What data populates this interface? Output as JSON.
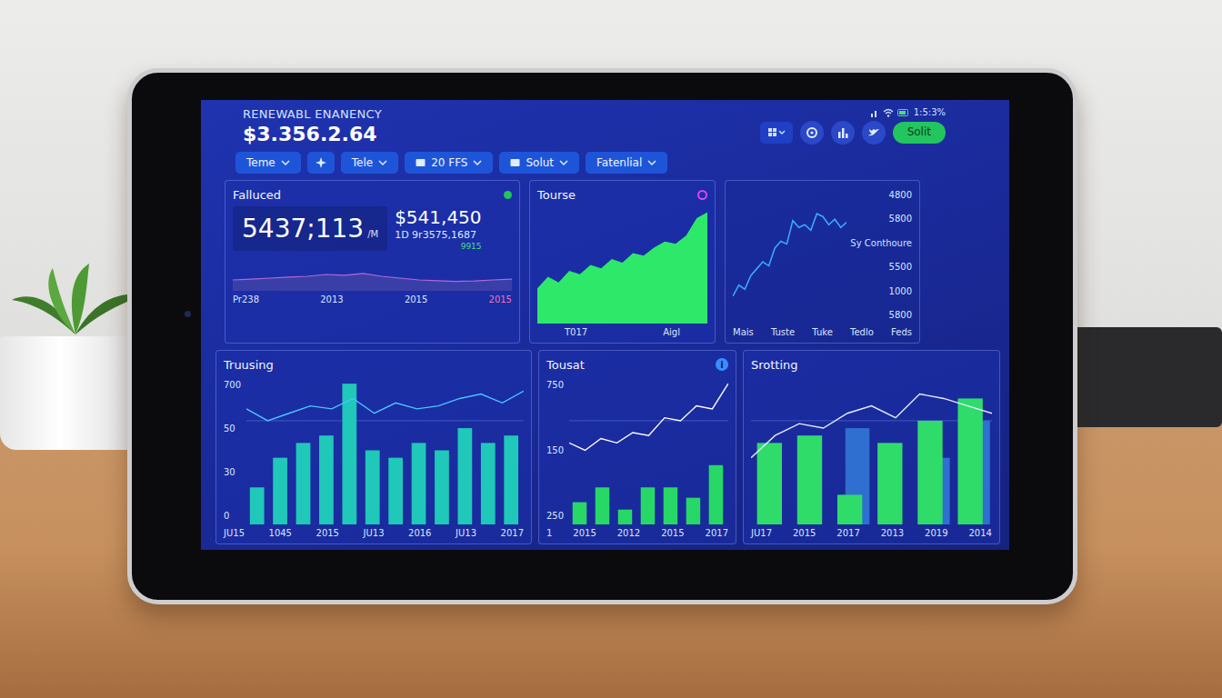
{
  "screen": {
    "title": "RENEWABL ENANENCY",
    "total": "$3.356.2.64",
    "status": "1:5:3%",
    "action_button": "Solit"
  },
  "filters": [
    {
      "label": "Teme",
      "kind": "dropdown"
    },
    {
      "label": "",
      "kind": "icon"
    },
    {
      "label": "Tele",
      "kind": "dropdown"
    },
    {
      "label": "20 FFS",
      "kind": "icon-dropdown"
    },
    {
      "label": "Solut",
      "kind": "icon-dropdown"
    },
    {
      "label": "Fatenlial",
      "kind": "dropdown"
    }
  ],
  "summary_panel": {
    "title": "Falluced",
    "dot_color": "#22c55e",
    "value": "5437;113",
    "unit": "/M",
    "amount": "$541,450",
    "detail": "1D 9r3575,1687",
    "change": "9915",
    "series": [
      30,
      32,
      35,
      38,
      40,
      45,
      43,
      48,
      40,
      35,
      30,
      28,
      26,
      27,
      30,
      32
    ],
    "x_labels": [
      {
        "text": "Pr238",
        "highlighted": false
      },
      {
        "text": "2013",
        "highlighted": false
      },
      {
        "text": "2015",
        "highlighted": false
      },
      {
        "text": "2015",
        "highlighted": true
      }
    ]
  },
  "growth_panel": {
    "title": "Tourse",
    "dot_color": "#d946ef",
    "series": [
      30,
      40,
      35,
      45,
      42,
      50,
      47,
      55,
      52,
      60,
      58,
      65,
      70,
      68,
      75,
      90,
      95
    ],
    "x_labels": [
      "T017",
      "Aigl"
    ]
  },
  "trend_panel": {
    "legend": "Sy Conthoure",
    "y_ticks": [
      "4800",
      "5800",
      "5500",
      "1000",
      "5800"
    ],
    "x_labels": [
      "Mais",
      "Tuste",
      "Tuke",
      "Tedlo",
      "Feds"
    ],
    "series": [
      20,
      28,
      25,
      35,
      40,
      45,
      42,
      55,
      60,
      58,
      75,
      70,
      72,
      68,
      80,
      78,
      72,
      76,
      70,
      74
    ]
  },
  "bottom_panels": [
    {
      "title": "Truusing",
      "badge": "",
      "y_ticks": [
        "700",
        "50",
        "30",
        "0"
      ],
      "x_labels": [
        "JU15",
        "1045",
        "2015",
        "JU13",
        "2016",
        "JU13",
        "2017"
      ],
      "bars": [
        25,
        45,
        55,
        60,
        95,
        50,
        45,
        55,
        50,
        65,
        55,
        60
      ],
      "back_bars": [],
      "line": [
        78,
        70,
        75,
        80,
        78,
        85,
        75,
        82,
        78,
        80,
        85,
        88,
        82,
        90
      ]
    },
    {
      "title": "Tousat",
      "badge": "i",
      "y_ticks": [
        "750",
        "150",
        "250"
      ],
      "x_labels": [
        "1",
        "2015",
        "2012",
        "2015",
        "2017"
      ],
      "bars": [
        15,
        25,
        10,
        25,
        25,
        18,
        40
      ],
      "back_bars": [],
      "line": [
        55,
        50,
        58,
        55,
        62,
        60,
        72,
        70,
        80,
        78,
        95
      ]
    },
    {
      "title": "Srotting",
      "badge": "",
      "y_ticks": [],
      "x_labels": [
        "JU17",
        "2015",
        "2017",
        "2013",
        "2019",
        "2014"
      ],
      "bars": [
        55,
        60,
        20,
        55,
        70,
        85
      ],
      "back_bars": [
        0,
        0,
        65,
        0,
        45,
        70
      ],
      "line": [
        45,
        60,
        68,
        65,
        75,
        80,
        72,
        88,
        85,
        80,
        75
      ]
    }
  ]
}
